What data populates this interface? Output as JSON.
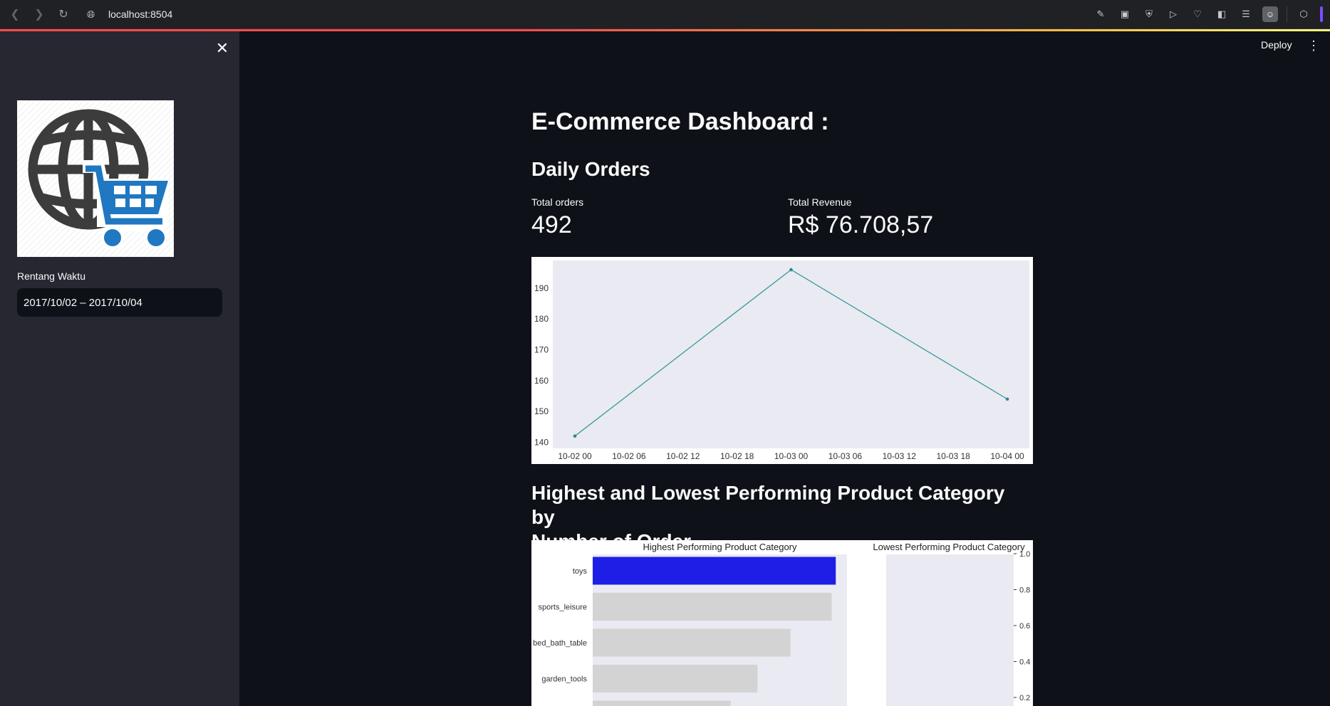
{
  "browser": {
    "url": "localhost:8504"
  },
  "sidebar": {
    "date_range_label": "Rentang Waktu",
    "date_range_value": "2017/10/02 – 2017/10/04"
  },
  "header": {
    "deploy_label": "Deploy"
  },
  "main": {
    "title": "E-Commerce Dashboard :",
    "daily_orders_heading": "Daily Orders",
    "metric_orders_label": "Total orders",
    "metric_orders_value": "492",
    "metric_revenue_label": "Total Revenue",
    "metric_revenue_value": "R$ 76.708,57",
    "category_heading_line1": "Highest and Lowest Performing Product Category by",
    "category_heading_line2": "Number of Order"
  },
  "colors": {
    "line": "#3a9a9a",
    "highlight_bar": "#1e1ee6",
    "other_bar": "#d3d3d3",
    "plot_bg": "#eaeaf2"
  },
  "chart_data": [
    {
      "type": "line",
      "x": [
        "10-02 00",
        "10-03 00",
        "10-04 00"
      ],
      "values": [
        142,
        196,
        154
      ],
      "xticks": [
        "10-02 00",
        "10-02 06",
        "10-02 12",
        "10-02 18",
        "10-03 00",
        "10-03 06",
        "10-03 12",
        "10-03 18",
        "10-04 00"
      ],
      "yticks": [
        140,
        150,
        160,
        170,
        180,
        190
      ],
      "ylim": [
        138,
        199
      ],
      "grid": false
    },
    {
      "type": "bar",
      "title": "Highest Performing Product Category",
      "categories": [
        "toys",
        "sports_leisure",
        "bed_bath_table",
        "garden_tools"
      ],
      "values": [
        59,
        58,
        48,
        40
      ],
      "highlight_index": 0
    },
    {
      "type": "bar",
      "title": "Lowest Performing Product Category",
      "categories": [],
      "values": [],
      "yticks": [
        "1.0",
        "0.8",
        "0.6",
        "0.4",
        "0.2"
      ]
    }
  ]
}
